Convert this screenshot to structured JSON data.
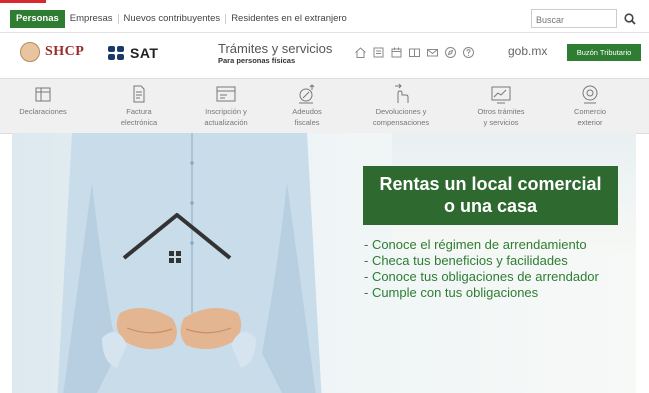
{
  "topnav": {
    "tabs": [
      "Personas",
      "Empresas",
      "Nuevos contribuyentes",
      "Residentes en el extranjero"
    ],
    "search_placeholder": "Buscar"
  },
  "header": {
    "shcp_logo": "SHCP",
    "sat_logo": "SAT",
    "tramites_title": "Trámites y servicios",
    "tramites_subtitle": "Para personas físicas",
    "icons": [
      "home-icon",
      "document-icon",
      "calendar-icon",
      "book-icon",
      "mail-icon",
      "compass-icon",
      "help-icon"
    ],
    "gob_link": "gob.mx",
    "buzon_button": "Buzón Tributario"
  },
  "services": [
    {
      "l1": "Declaraciones",
      "l2": "",
      "icon": "declaraciones-icon"
    },
    {
      "l1": "Factura",
      "l2": "electrónica",
      "icon": "factura-icon"
    },
    {
      "l1": "Inscripción y",
      "l2": "actualización",
      "icon": "inscripcion-icon"
    },
    {
      "l1": "Adeudos",
      "l2": "fiscales",
      "icon": "adeudos-icon"
    },
    {
      "l1": "Devoluciones y",
      "l2": "compensaciones",
      "icon": "devoluciones-icon"
    },
    {
      "l1": "Otros trámites",
      "l2": "y servicios",
      "icon": "otros-tramites-icon"
    },
    {
      "l1": "Comercio",
      "l2": "exterior",
      "icon": "comercio-exterior-icon"
    }
  ],
  "hero": {
    "banner_line1": "Rentas un local comercial",
    "banner_line2": "o una casa",
    "bullets": [
      "- Conoce el régimen de arrendamiento",
      "- Checa tus beneficios y facilidades",
      "- Conoce tus obligaciones de arrendador",
      "- Cumple con tus obligaciones"
    ]
  },
  "colors": {
    "accent_green": "#2e7d32",
    "banner_green": "#2e6a2f",
    "shcp_red": "#9c2a2a",
    "sat_navy": "#1b3a6b"
  }
}
